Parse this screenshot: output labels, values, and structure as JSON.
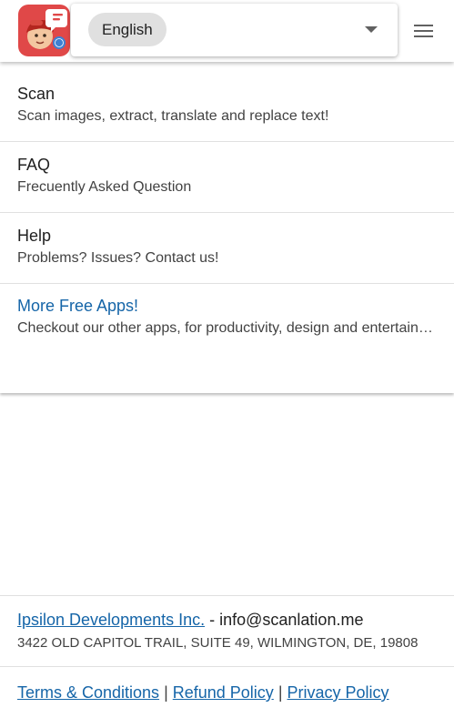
{
  "header": {
    "language_selected": "English"
  },
  "menu": {
    "items": [
      {
        "title": "Scan",
        "subtitle": "Scan images, extract, translate and replace text!"
      },
      {
        "title": "FAQ",
        "subtitle": "Frecuently Asked Question"
      },
      {
        "title": "Help",
        "subtitle": "Problems? Issues? Contact us!"
      },
      {
        "title": "More Free Apps!",
        "subtitle": "Checkout our other apps, for productivity, design and entertainment"
      }
    ]
  },
  "footer": {
    "company_name": "Ipsilon Developments Inc.",
    "contact_text": " - info@scanlation.me",
    "address": "3422 OLD CAPITOL TRAIL, SUITE 49, WILMINGTON, DE, 19808",
    "links": {
      "terms": "Terms & Conditions",
      "refund": "Refund Policy",
      "privacy": "Privacy Policy",
      "separator": "|"
    }
  },
  "colors": {
    "link": "#1565a8",
    "logo_background": "#e04848"
  },
  "icons": {
    "logo": "app-logo-icon",
    "dropdown": "dropdown-arrow-icon",
    "menu": "hamburger-menu-icon"
  }
}
